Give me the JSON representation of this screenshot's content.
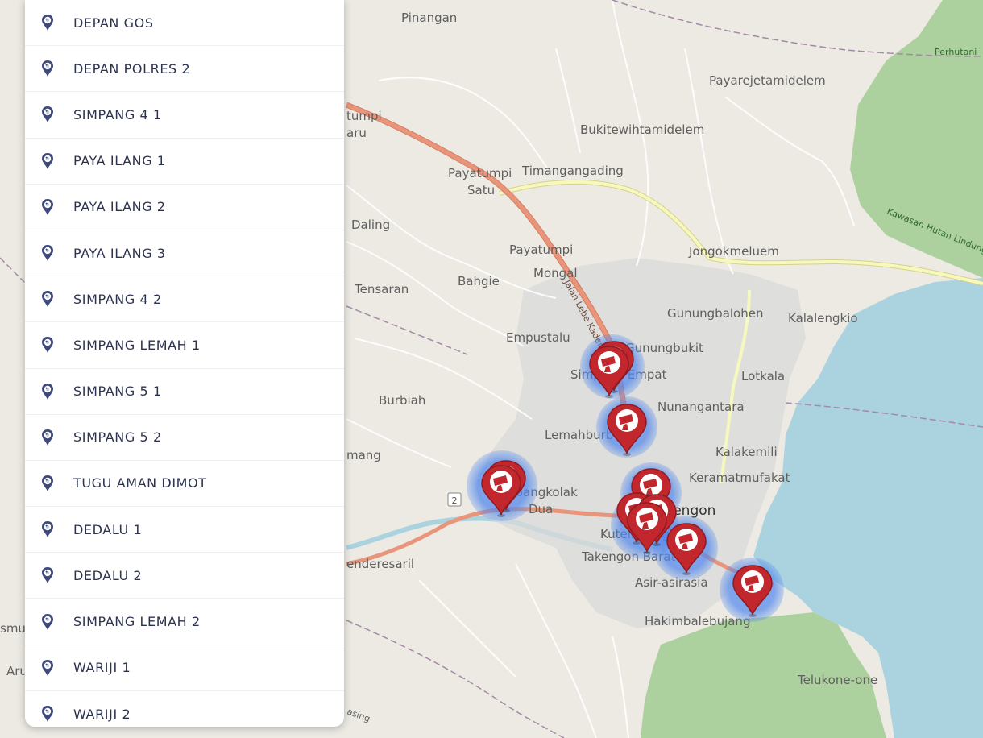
{
  "location_list": [
    "DEPAN GOS",
    "DEPAN POLRES 2",
    "SIMPANG 4 1",
    "PAYA ILANG 1",
    "PAYA ILANG 2",
    "PAYA ILANG 3",
    "SIMPANG 4 2",
    "SIMPANG LEMAH 1",
    "SIMPANG 5 1",
    "SIMPANG 5 2",
    "TUGU AMAN DIMOT",
    "DEDALU 1",
    "DEDALU 2",
    "SIMPANG LEMAH 2",
    "WARIJI 1",
    "WARIJI 2"
  ],
  "map": {
    "places": {
      "pinangan": "Pinangan",
      "payarejetamidelem": "Payarejetamidelem",
      "perhutani": "Perhutani",
      "bukitewihtamidelem": "Bukitewihtamidelem",
      "payatumpi_satu_1": "Payatumpi",
      "payatumpi_satu_2": "Satu",
      "timangangading": "Timangangading",
      "tumpi": "tumpi",
      "aru": "aru",
      "daling": "Daling",
      "payatumpi": "Payatumpi",
      "mongal": "Mongal",
      "jongokmeluem": "Jongokmeluem",
      "tensaran": "Tensaran",
      "bahgie": "Bahgie",
      "gunungbalohen": "Gunungbalohen",
      "kalalengkio": "Kalalengkio",
      "empustalu": "Empustalu",
      "gunungbukit": "Gunungbukit",
      "simpang_empat": "Simpang Empat",
      "lotkala": "Lotkala",
      "burbiah": "Burbiah",
      "nunangantara": "Nunangantara",
      "lemahburbana": "Lemahburbana",
      "kalakemili": "Kalakemili",
      "mang": "mang",
      "keramatmufakat": "Keramatmufakat",
      "bebangkolak": "Bebangkolak",
      "dua": "Dua",
      "takengon": "Takengon",
      "kutelintang": "Kutelintang",
      "takengon_barat": "Takengon Barat",
      "enderesaril": "enderesaril",
      "asir_asir": "Asir-asirasia",
      "hakimbalebujang": "Hakimbalebujang",
      "telukone_one": "Telukone-one",
      "smul": "smul",
      "aru2": "Aru",
      "kawasan": "Kawasan Hutan Lindung",
      "jalan": "Jalan Lebe Kader",
      "asing": "asing",
      "route": "2"
    },
    "colors": {
      "land": "#eceae3",
      "water": "#aad3df",
      "forest": "#add19e",
      "urban": "#d9d9d9",
      "primary_road": "#e8957b",
      "secondary_road": "#f6f9be",
      "marker": "#c1272d",
      "cluster": "#5b8ff0"
    },
    "marker_icon": "cctv-camera-pin-icon"
  }
}
